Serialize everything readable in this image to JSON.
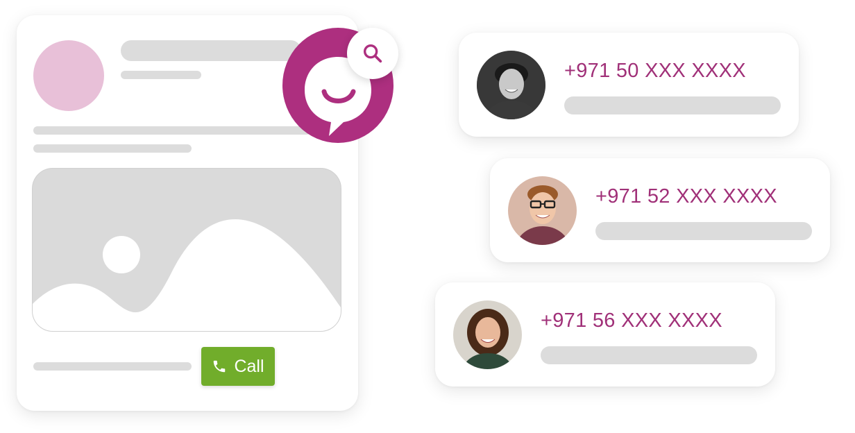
{
  "listing": {
    "call_button_label": "Call",
    "call_icon": "phone-icon",
    "image_icon": "image-placeholder-icon"
  },
  "brand": {
    "logo_icon": "chat-smile-icon",
    "search_icon": "search-icon",
    "colors": {
      "brand": "#ad2f7f",
      "phone_text": "#a03078",
      "call_green": "#71ad2b",
      "placeholder_gray": "#dcdcdc",
      "avatar_pink": "#e8c0d8"
    }
  },
  "contacts": [
    {
      "phone": "+971 50 XXX XXXX",
      "photo": "person-1-photo"
    },
    {
      "phone": "+971 52 XXX XXXX",
      "photo": "person-2-photo"
    },
    {
      "phone": "+971 56 XXX XXXX",
      "photo": "person-3-photo"
    }
  ]
}
